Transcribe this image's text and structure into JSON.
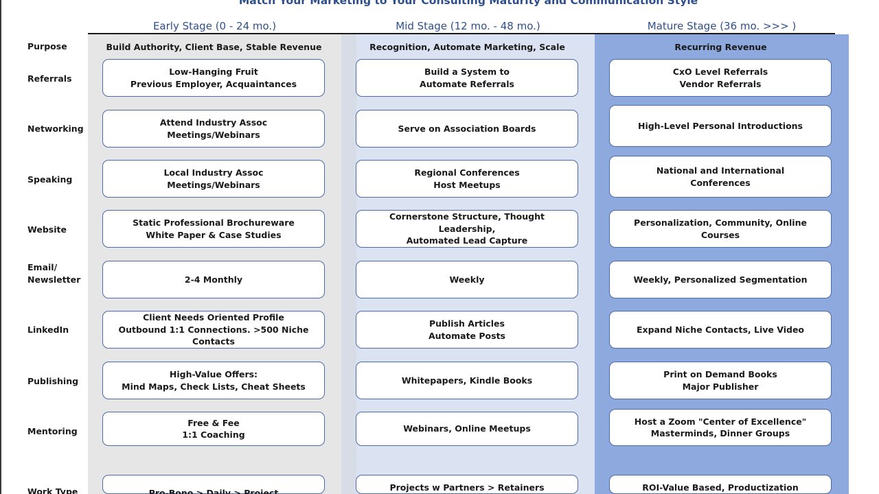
{
  "title": "Match Your Marketing to Your Consulting Maturity and Communication Style",
  "columns": [
    {
      "header": "Early Stage (0 - 24 mo.)",
      "purpose": "Build Authority, Client Base, Stable Revenue"
    },
    {
      "header": "Mid Stage (12 mo. - 48 mo.)",
      "purpose": "Recognition, Automate Marketing, Scale"
    },
    {
      "header": "Mature Stage (36 mo. >>> )",
      "purpose": "Recurring Revenue"
    }
  ],
  "purpose_label": "Purpose",
  "rows": [
    {
      "label": "Referrals",
      "cells": [
        "Low-Hanging Fruit\nPrevious Employer, Acquaintances",
        "Build a System to\nAutomate Referrals",
        "CxO Level Referrals\nVendor Referrals"
      ]
    },
    {
      "label": "Networking",
      "cells": [
        "Attend Industry Assoc\nMeetings/Webinars",
        "Serve on Association Boards",
        "High-Level Personal Introductions"
      ]
    },
    {
      "label": "Speaking",
      "cells": [
        "Local Industry Assoc\nMeetings/Webinars",
        "Regional Conferences\nHost Meetups",
        "National and International\nConferences"
      ]
    },
    {
      "label": "Website",
      "cells": [
        "Static Professional Brochureware\nWhite Paper & Case Studies",
        "Cornerstone Structure, Thought Leadership,\nAutomated Lead Capture",
        "Personalization, Community, Online Courses"
      ]
    },
    {
      "label": "Email/\nNewsletter",
      "cells": [
        "2-4 Monthly",
        "Weekly",
        "Weekly, Personalized Segmentation"
      ]
    },
    {
      "label": "LinkedIn",
      "cells": [
        "Client Needs Oriented Profile\nOutbound 1:1 Connections. >500 Niche Contacts",
        "Publish Articles\nAutomate Posts",
        "Expand Niche Contacts, Live Video"
      ]
    },
    {
      "label": "Publishing",
      "cells": [
        "High-Value Offers:\nMind Maps, Check Lists, Cheat Sheets",
        "Whitepapers, Kindle Books",
        "Print on Demand Books\nMajor Publisher"
      ]
    },
    {
      "label": "Mentoring",
      "cells": [
        "Free & Fee\n1:1 Coaching",
        "Webinars, Online Meetups",
        "Host a Zoom \"Center of Excellence\"\nMasterminds, Dinner Groups"
      ]
    },
    {
      "label": "Work Type",
      "cells": [
        "Pro-Bono > Daily > Project",
        "Projects w Partners > Retainers",
        "ROI-Value Based, Productization"
      ]
    }
  ]
}
